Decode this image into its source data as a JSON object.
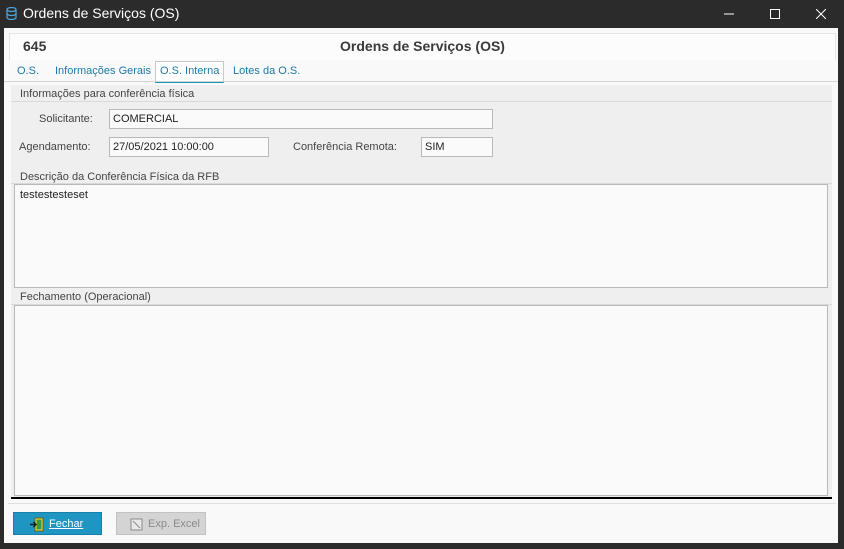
{
  "window": {
    "title": "Ordens de Serviços (OS)"
  },
  "header": {
    "os_number": "645",
    "form_title": "Ordens de Serviços (OS)"
  },
  "tabs": [
    {
      "label": "O.S.",
      "active": false
    },
    {
      "label": "Informações Gerais",
      "active": false
    },
    {
      "label": "O.S. Interna",
      "active": true
    },
    {
      "label": "Lotes da O.S.",
      "active": false
    }
  ],
  "section": {
    "title": "Informações para conferência física",
    "solicitante_label": "Solicitante:",
    "solicitante_value": "COMERCIAL",
    "agendamento_label": "Agendamento:",
    "agendamento_value": "27/05/2021 10:00:00",
    "conferencia_label": "Conferência Remota:",
    "conferencia_value": "SIM"
  },
  "descricao": {
    "label": "Descrição da Conferência Física da RFB",
    "value": "testestesteset"
  },
  "fechamento": {
    "label": "Fechamento (Operacional)",
    "value": ""
  },
  "footer": {
    "fechar_label": "Fechar",
    "excel_label": "Exp. Excel"
  },
  "colors": {
    "accent": "#1f95c2",
    "tab_text": "#1e78a8",
    "titlebar": "#2b2b2b"
  }
}
